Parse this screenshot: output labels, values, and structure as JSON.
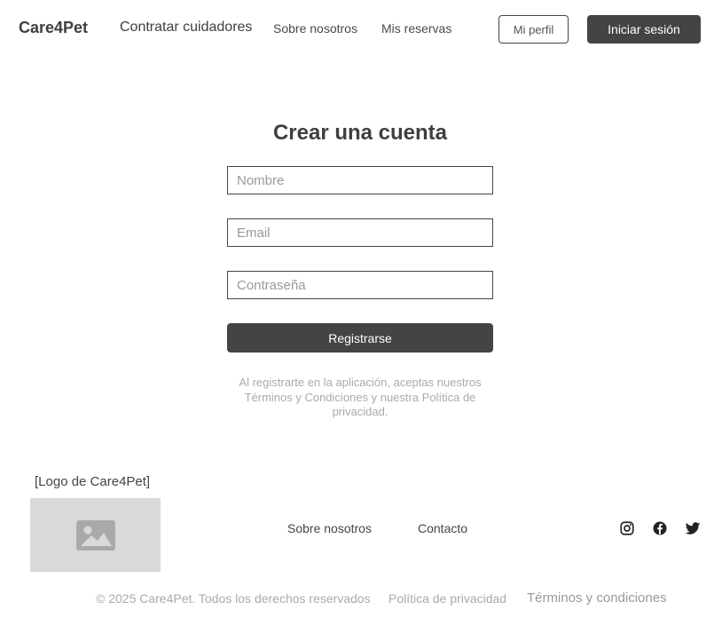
{
  "header": {
    "brand": "Care4Pet",
    "nav": {
      "hire": "Contratar cuidadores",
      "about": "Sobre nosotros",
      "bookings": "Mis reservas"
    },
    "profile_label": "Mi perfil",
    "login_label": "Iniciar sesión"
  },
  "form": {
    "title": "Crear una cuenta",
    "name_placeholder": "Nombre",
    "email_placeholder": "Email",
    "password_placeholder": "Contraseña",
    "submit_label": "Registrarse",
    "terms_text": "Al registrarte en la aplicación, aceptas nuestros Términos y Condiciones y nuestra Política de privacidad."
  },
  "footer": {
    "logo_label": "[Logo de Care4Pet]",
    "logo_image_icon": "image-placeholder-icon",
    "links": {
      "about": "Sobre nosotros",
      "contact": "Contacto"
    },
    "social_icons": [
      "instagram-icon",
      "facebook-icon",
      "twitter-icon"
    ],
    "copyright": "© 2025 Care4Pet. Todos los derechos reservados",
    "privacy": "Política de privacidad",
    "conditions": "Términos y condiciones"
  },
  "colors": {
    "primary": "#444444",
    "muted_text": "#aaaaaa",
    "placeholder_bg": "#d9d9d9"
  }
}
